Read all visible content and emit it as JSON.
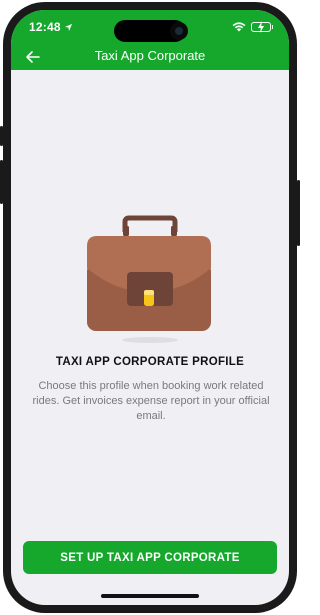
{
  "status_bar": {
    "time": "12:48",
    "location_icon": "location-arrow-icon",
    "wifi_icon": "wifi-icon",
    "battery_icon": "battery-charging-icon"
  },
  "header": {
    "title": "Taxi App Corporate",
    "back_icon": "back-arrow-icon"
  },
  "main": {
    "illustration_icon": "briefcase-icon",
    "title": "TAXI APP CORPORATE PROFILE",
    "description": "Choose this profile when booking work related rides. Get invoices expense report in your official email."
  },
  "footer": {
    "cta_label": "SET UP TAXI APP CORPORATE"
  },
  "colors": {
    "brand_green": "#15a82d",
    "screen_bg": "#f0eff4",
    "briefcase_brown": "#b06f52",
    "briefcase_dark": "#9a5e47",
    "clasp_yellow": "#f5c518"
  }
}
